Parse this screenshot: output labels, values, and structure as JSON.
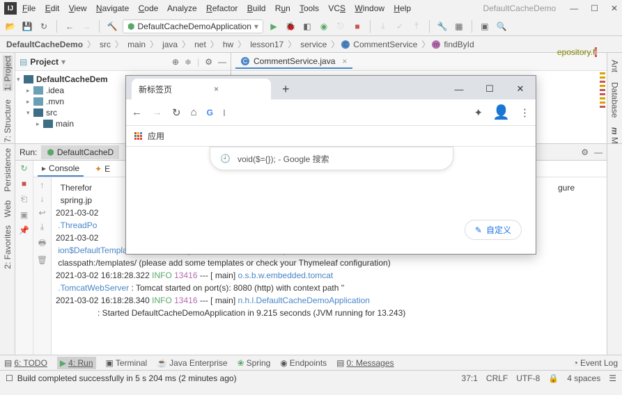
{
  "window": {
    "title": "DefaultCacheDemo"
  },
  "menu": {
    "file": "File",
    "edit": "Edit",
    "view": "View",
    "navigate": "Navigate",
    "code": "Code",
    "analyze": "Analyze",
    "refactor": "Refactor",
    "build": "Build",
    "run": "Run",
    "tools": "Tools",
    "vcs": "VCS",
    "window": "Window",
    "help": "Help"
  },
  "runcfg": {
    "label": "DefaultCacheDemoApplication"
  },
  "breadcrumbs": [
    "DefaultCacheDemo",
    "src",
    "main",
    "java",
    "net",
    "hw",
    "lesson17",
    "service",
    "CommentService",
    "findById"
  ],
  "projpanel": {
    "title": "Project"
  },
  "tree": {
    "root": "DefaultCacheDem",
    "idea": ".idea",
    "mvn": ".mvn",
    "src": "src",
    "main": "main"
  },
  "editor": {
    "tab": "CommentService.java",
    "codefrag": "epository.f"
  },
  "lefttabs": {
    "project": "1: Project",
    "structure": "7: Structure"
  },
  "runlefttabs": {
    "favorites": "2: Favorites",
    "web": "Web",
    "persistence": "Persistence"
  },
  "righttabs": {
    "ant": "Ant",
    "database": "Database",
    "maven": "Maven"
  },
  "runpanel": {
    "title": "Run:",
    "tab": "DefaultCacheD"
  },
  "consoletabs": {
    "console": "Console",
    "endpoints": "E"
  },
  "log": {
    "l1a": "Therefor",
    "l1b": "gure",
    "l2": "spring.jp",
    "l3": "2021-03-02",
    "l4": ".ThreadPo",
    "l5": "2021-03-02",
    "l6": "ion$DefaultTemplateResolverConfiguration : Cannot find template location:",
    "l7": "classpath:/templates/ (please add some templates or check your Thymeleaf configuration)",
    "l8t": "2021-03-02 16:18:28.322  ",
    "l8i": "INFO",
    "l8n": " 13416",
    "l8m": " --- [           main] ",
    "l8c": "o.s.b.w.embedded.tomcat",
    "l9a": ".TomcatWebServer",
    "l9b": "  : Tomcat started on port(s): 8080 (http) with context path ''",
    "l10t": "2021-03-02 16:18:28.340  ",
    "l10i": "INFO",
    "l10n": " 13416",
    "l10m": " --- [           main] ",
    "l10c": "n.h.l.DefaultCacheDemoApplication",
    "l11": ": Started DefaultCacheDemoApplication in 9.215 seconds (JVM running for 13.243)"
  },
  "bottombar": {
    "todo": "6: TODO",
    "run": "4: Run",
    "terminal": "Terminal",
    "javaee": "Java Enterprise",
    "spring": "Spring",
    "endpoints": "Endpoints",
    "messages": "0: Messages",
    "eventlog": "Event Log"
  },
  "status": {
    "msg": "Build completed successfully in 5 s 204 ms (2 minutes ago)",
    "pos": "37:1",
    "eol": "CRLF",
    "enc": "UTF-8",
    "indent": "4 spaces"
  },
  "chrome": {
    "tab": "新标签页",
    "addrbar_cursor": "I",
    "apps": "应用",
    "suggest": "void($={}); - Google 搜索",
    "customize": "自定义"
  }
}
